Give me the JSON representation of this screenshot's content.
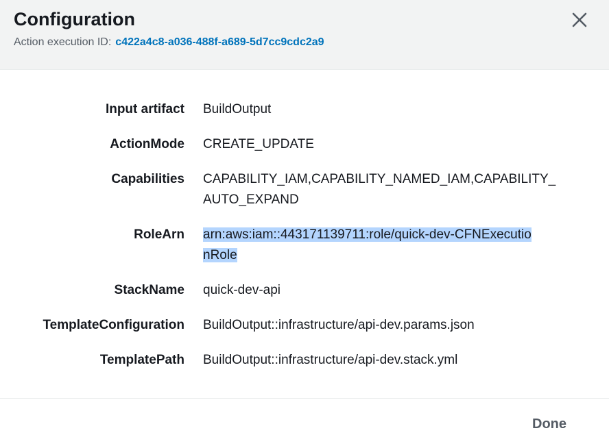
{
  "modal": {
    "title": "Configuration",
    "subtitle_label": "Action execution ID:",
    "execution_id": "c422a4c8-a036-488f-a689-5d7cc9cdc2a9",
    "close_icon": "close-icon"
  },
  "config": {
    "rows": [
      {
        "label": "Input artifact",
        "value": "BuildOutput"
      },
      {
        "label": "ActionMode",
        "value": "CREATE_UPDATE"
      },
      {
        "label": "Capabilities",
        "value_line1": "CAPABILITY_IAM,CAPABILITY_NAMED_IAM,CAPABILITY_",
        "value_line2": "AUTO_EXPAND"
      },
      {
        "label": "RoleArn",
        "value_line1": "arn:aws:iam::443171139711:role/quick-dev-CFNExecutio",
        "value_line2": "nRole"
      },
      {
        "label": "StackName",
        "value": "quick-dev-api"
      },
      {
        "label": "TemplateConfiguration",
        "value": "BuildOutput::infrastructure/api-dev.params.json"
      },
      {
        "label": "TemplatePath",
        "value": "BuildOutput::infrastructure/api-dev.stack.yml"
      }
    ]
  },
  "footer": {
    "done_label": "Done"
  },
  "colors": {
    "header_bg": "#f2f3f3",
    "link": "#0073bb",
    "selection": "#b4d5fe",
    "text": "#16191f",
    "muted": "#545b64"
  }
}
